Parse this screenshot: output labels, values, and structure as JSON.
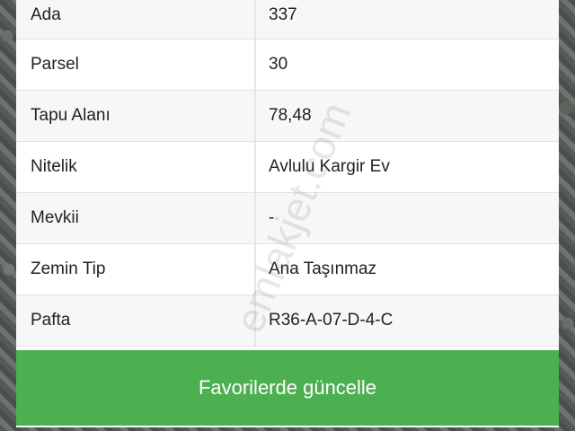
{
  "property_details": {
    "rows": [
      {
        "label": "Ada",
        "value": "337"
      },
      {
        "label": "Parsel",
        "value": "30"
      },
      {
        "label": "Tapu Alanı",
        "value": "78,48"
      },
      {
        "label": "Nitelik",
        "value": "Avlulu Kargir Ev"
      },
      {
        "label": "Mevkii",
        "value": "-"
      },
      {
        "label": "Zemin Tip",
        "value": "Ana Taşınmaz"
      },
      {
        "label": "Pafta",
        "value": "R36-A-07-D-4-C"
      }
    ]
  },
  "actions": {
    "update_favorites_label": "Favorilerde güncelle"
  },
  "watermark": {
    "text": "emlakjet.com"
  },
  "colors": {
    "accent": "#4caf50"
  }
}
